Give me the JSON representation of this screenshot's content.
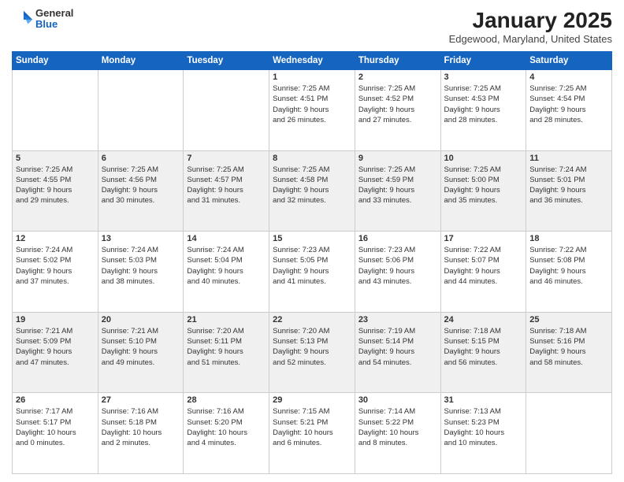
{
  "header": {
    "logo_general": "General",
    "logo_blue": "Blue",
    "month": "January 2025",
    "location": "Edgewood, Maryland, United States"
  },
  "days": [
    "Sunday",
    "Monday",
    "Tuesday",
    "Wednesday",
    "Thursday",
    "Friday",
    "Saturday"
  ],
  "weeks": [
    [
      {
        "num": "",
        "lines": []
      },
      {
        "num": "",
        "lines": []
      },
      {
        "num": "",
        "lines": []
      },
      {
        "num": "1",
        "lines": [
          "Sunrise: 7:25 AM",
          "Sunset: 4:51 PM",
          "Daylight: 9 hours",
          "and 26 minutes."
        ]
      },
      {
        "num": "2",
        "lines": [
          "Sunrise: 7:25 AM",
          "Sunset: 4:52 PM",
          "Daylight: 9 hours",
          "and 27 minutes."
        ]
      },
      {
        "num": "3",
        "lines": [
          "Sunrise: 7:25 AM",
          "Sunset: 4:53 PM",
          "Daylight: 9 hours",
          "and 28 minutes."
        ]
      },
      {
        "num": "4",
        "lines": [
          "Sunrise: 7:25 AM",
          "Sunset: 4:54 PM",
          "Daylight: 9 hours",
          "and 28 minutes."
        ]
      }
    ],
    [
      {
        "num": "5",
        "lines": [
          "Sunrise: 7:25 AM",
          "Sunset: 4:55 PM",
          "Daylight: 9 hours",
          "and 29 minutes."
        ]
      },
      {
        "num": "6",
        "lines": [
          "Sunrise: 7:25 AM",
          "Sunset: 4:56 PM",
          "Daylight: 9 hours",
          "and 30 minutes."
        ]
      },
      {
        "num": "7",
        "lines": [
          "Sunrise: 7:25 AM",
          "Sunset: 4:57 PM",
          "Daylight: 9 hours",
          "and 31 minutes."
        ]
      },
      {
        "num": "8",
        "lines": [
          "Sunrise: 7:25 AM",
          "Sunset: 4:58 PM",
          "Daylight: 9 hours",
          "and 32 minutes."
        ]
      },
      {
        "num": "9",
        "lines": [
          "Sunrise: 7:25 AM",
          "Sunset: 4:59 PM",
          "Daylight: 9 hours",
          "and 33 minutes."
        ]
      },
      {
        "num": "10",
        "lines": [
          "Sunrise: 7:25 AM",
          "Sunset: 5:00 PM",
          "Daylight: 9 hours",
          "and 35 minutes."
        ]
      },
      {
        "num": "11",
        "lines": [
          "Sunrise: 7:24 AM",
          "Sunset: 5:01 PM",
          "Daylight: 9 hours",
          "and 36 minutes."
        ]
      }
    ],
    [
      {
        "num": "12",
        "lines": [
          "Sunrise: 7:24 AM",
          "Sunset: 5:02 PM",
          "Daylight: 9 hours",
          "and 37 minutes."
        ]
      },
      {
        "num": "13",
        "lines": [
          "Sunrise: 7:24 AM",
          "Sunset: 5:03 PM",
          "Daylight: 9 hours",
          "and 38 minutes."
        ]
      },
      {
        "num": "14",
        "lines": [
          "Sunrise: 7:24 AM",
          "Sunset: 5:04 PM",
          "Daylight: 9 hours",
          "and 40 minutes."
        ]
      },
      {
        "num": "15",
        "lines": [
          "Sunrise: 7:23 AM",
          "Sunset: 5:05 PM",
          "Daylight: 9 hours",
          "and 41 minutes."
        ]
      },
      {
        "num": "16",
        "lines": [
          "Sunrise: 7:23 AM",
          "Sunset: 5:06 PM",
          "Daylight: 9 hours",
          "and 43 minutes."
        ]
      },
      {
        "num": "17",
        "lines": [
          "Sunrise: 7:22 AM",
          "Sunset: 5:07 PM",
          "Daylight: 9 hours",
          "and 44 minutes."
        ]
      },
      {
        "num": "18",
        "lines": [
          "Sunrise: 7:22 AM",
          "Sunset: 5:08 PM",
          "Daylight: 9 hours",
          "and 46 minutes."
        ]
      }
    ],
    [
      {
        "num": "19",
        "lines": [
          "Sunrise: 7:21 AM",
          "Sunset: 5:09 PM",
          "Daylight: 9 hours",
          "and 47 minutes."
        ]
      },
      {
        "num": "20",
        "lines": [
          "Sunrise: 7:21 AM",
          "Sunset: 5:10 PM",
          "Daylight: 9 hours",
          "and 49 minutes."
        ]
      },
      {
        "num": "21",
        "lines": [
          "Sunrise: 7:20 AM",
          "Sunset: 5:11 PM",
          "Daylight: 9 hours",
          "and 51 minutes."
        ]
      },
      {
        "num": "22",
        "lines": [
          "Sunrise: 7:20 AM",
          "Sunset: 5:13 PM",
          "Daylight: 9 hours",
          "and 52 minutes."
        ]
      },
      {
        "num": "23",
        "lines": [
          "Sunrise: 7:19 AM",
          "Sunset: 5:14 PM",
          "Daylight: 9 hours",
          "and 54 minutes."
        ]
      },
      {
        "num": "24",
        "lines": [
          "Sunrise: 7:18 AM",
          "Sunset: 5:15 PM",
          "Daylight: 9 hours",
          "and 56 minutes."
        ]
      },
      {
        "num": "25",
        "lines": [
          "Sunrise: 7:18 AM",
          "Sunset: 5:16 PM",
          "Daylight: 9 hours",
          "and 58 minutes."
        ]
      }
    ],
    [
      {
        "num": "26",
        "lines": [
          "Sunrise: 7:17 AM",
          "Sunset: 5:17 PM",
          "Daylight: 10 hours",
          "and 0 minutes."
        ]
      },
      {
        "num": "27",
        "lines": [
          "Sunrise: 7:16 AM",
          "Sunset: 5:18 PM",
          "Daylight: 10 hours",
          "and 2 minutes."
        ]
      },
      {
        "num": "28",
        "lines": [
          "Sunrise: 7:16 AM",
          "Sunset: 5:20 PM",
          "Daylight: 10 hours",
          "and 4 minutes."
        ]
      },
      {
        "num": "29",
        "lines": [
          "Sunrise: 7:15 AM",
          "Sunset: 5:21 PM",
          "Daylight: 10 hours",
          "and 6 minutes."
        ]
      },
      {
        "num": "30",
        "lines": [
          "Sunrise: 7:14 AM",
          "Sunset: 5:22 PM",
          "Daylight: 10 hours",
          "and 8 minutes."
        ]
      },
      {
        "num": "31",
        "lines": [
          "Sunrise: 7:13 AM",
          "Sunset: 5:23 PM",
          "Daylight: 10 hours",
          "and 10 minutes."
        ]
      },
      {
        "num": "",
        "lines": []
      }
    ]
  ]
}
